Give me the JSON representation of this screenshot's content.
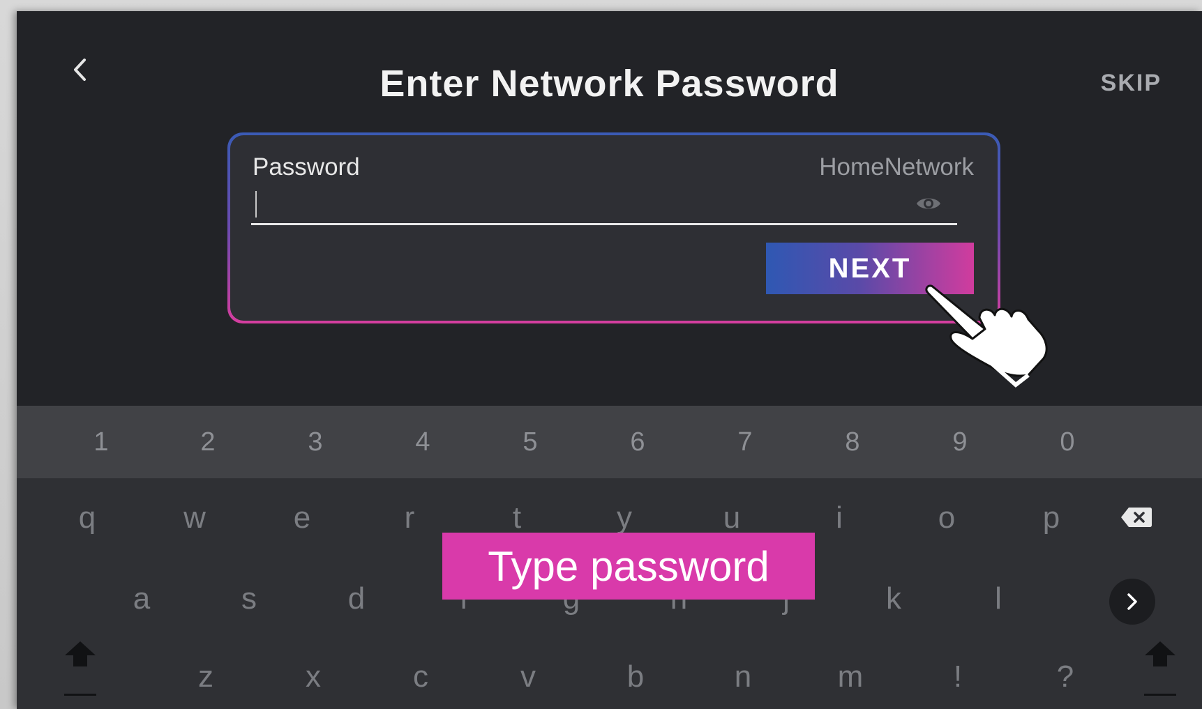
{
  "header": {
    "title": "Enter Network Password",
    "skip_label": "SKIP",
    "back_icon": "chevron-left-icon"
  },
  "password_card": {
    "field_label": "Password",
    "network_name": "HomeNetwork",
    "input_value": "",
    "eye_icon": "eye-icon",
    "next_label": "NEXT"
  },
  "keyboard": {
    "number_row": [
      "1",
      "2",
      "3",
      "4",
      "5",
      "6",
      "7",
      "8",
      "9",
      "0"
    ],
    "row1": [
      "q",
      "w",
      "e",
      "r",
      "t",
      "y",
      "u",
      "i",
      "o",
      "p"
    ],
    "row2": [
      "a",
      "s",
      "d",
      "f",
      "g",
      "h",
      "j",
      "k",
      "l"
    ],
    "row3": [
      "z",
      "x",
      "c",
      "v",
      "b",
      "n",
      "m",
      "!",
      "?"
    ],
    "backspace_icon": "backspace-icon",
    "go_icon": "chevron-right-icon",
    "shift_icon": "shift-arrow-icon"
  },
  "overlay": {
    "instruction": "Type password",
    "pointer_icon": "hand-pointer-icon"
  },
  "colors": {
    "background": "#222327",
    "accent_blue": "#2f58b3",
    "accent_pink": "#d93aaa"
  }
}
